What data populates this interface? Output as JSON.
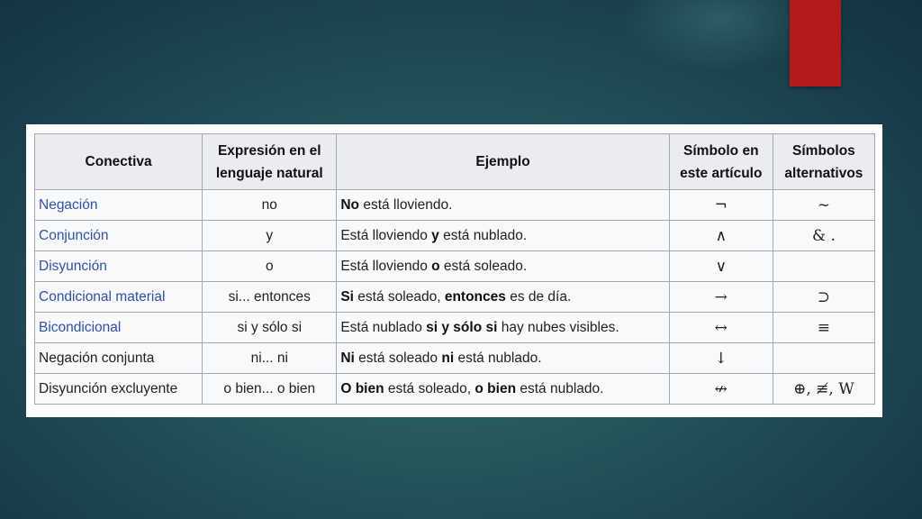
{
  "headers": {
    "connective": "Conectiva",
    "expression": "Expresión en el lenguaje natural",
    "example": "Ejemplo",
    "symbol": "Símbolo en este artículo",
    "alternatives": "Símbolos alternativos"
  },
  "rows": [
    {
      "connective": "Negación",
      "is_link": true,
      "expression": "no",
      "example": [
        {
          "t": "No",
          "b": true
        },
        {
          "t": " está lloviendo.",
          "b": false
        }
      ],
      "symbol": "¬",
      "alternatives": "∼"
    },
    {
      "connective": "Conjunción",
      "is_link": true,
      "expression": "y",
      "example": [
        {
          "t": "Está lloviendo ",
          "b": false
        },
        {
          "t": "y",
          "b": true
        },
        {
          "t": " está nublado.",
          "b": false
        }
      ],
      "symbol": "∧",
      "alternatives": "& ."
    },
    {
      "connective": "Disyunción",
      "is_link": true,
      "expression": "o",
      "example": [
        {
          "t": "Está lloviendo ",
          "b": false
        },
        {
          "t": "o",
          "b": true
        },
        {
          "t": " está soleado.",
          "b": false
        }
      ],
      "symbol": "∨",
      "alternatives": ""
    },
    {
      "connective": "Condicional material",
      "is_link": true,
      "expression": "si... entonces",
      "example": [
        {
          "t": "Si",
          "b": true
        },
        {
          "t": " está soleado, ",
          "b": false
        },
        {
          "t": "entonces",
          "b": true
        },
        {
          "t": " es de día.",
          "b": false
        }
      ],
      "symbol": "→",
      "alternatives": "⊃"
    },
    {
      "connective": "Bicondicional",
      "is_link": true,
      "expression": "si y sólo si",
      "example": [
        {
          "t": "Está nublado ",
          "b": false
        },
        {
          "t": "si y sólo si",
          "b": true
        },
        {
          "t": " hay nubes visibles.",
          "b": false
        }
      ],
      "symbol": "↔",
      "alternatives": "≡"
    },
    {
      "connective": "Negación conjunta",
      "is_link": false,
      "expression": "ni... ni",
      "example": [
        {
          "t": "Ni",
          "b": true
        },
        {
          "t": " está soleado ",
          "b": false
        },
        {
          "t": "ni",
          "b": true
        },
        {
          "t": " está nublado.",
          "b": false
        }
      ],
      "symbol": "↓",
      "alternatives": ""
    },
    {
      "connective": "Disyunción excluyente",
      "is_link": false,
      "expression": "o bien... o bien",
      "example": [
        {
          "t": "O bien",
          "b": true
        },
        {
          "t": " está soleado, ",
          "b": false
        },
        {
          "t": "o bien",
          "b": true
        },
        {
          "t": " está nublado.",
          "b": false
        }
      ],
      "symbol": "↮",
      "alternatives": "⊕, ≢, W"
    }
  ],
  "colors": {
    "link": "#2f4fb5",
    "header_bg": "#eaecf0",
    "cell_bg": "#f8f9fa",
    "accent_tab": "#b31a1a"
  }
}
